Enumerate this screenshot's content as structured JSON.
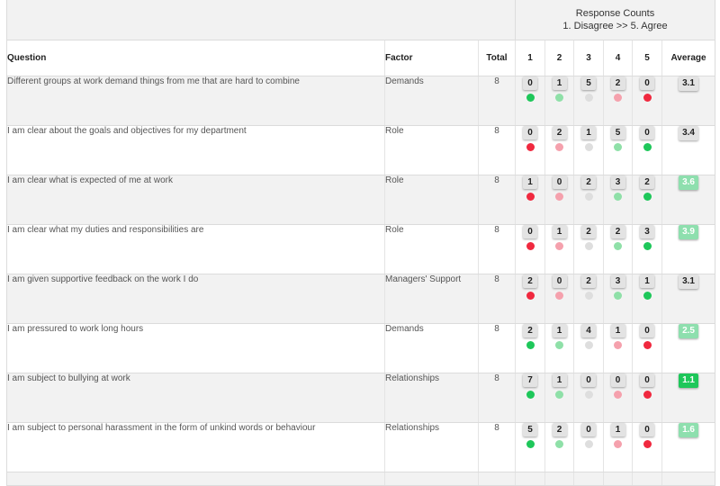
{
  "header": {
    "response_counts_title": "Response Counts",
    "scale_subtitle": "1. Disagree >> 5. Agree",
    "columns": {
      "question": "Question",
      "factor": "Factor",
      "total": "Total",
      "c1": "1",
      "c2": "2",
      "c3": "3",
      "c4": "4",
      "c5": "5",
      "average": "Average"
    }
  },
  "colors": {
    "green_strong": "#1ec75a",
    "green_light": "#8fe0a8",
    "grey": "#dedede",
    "pink": "#f5a1ad",
    "red": "#f0293f",
    "badge_grey": "#e3e3e3",
    "avg_green_light": "#8edfae",
    "avg_green_strong": "#1ec75a"
  },
  "rows": [
    {
      "question": "Different groups at work demand things from me that are hard to combine",
      "factor": "Demands",
      "total": "8",
      "counts": [
        "0",
        "1",
        "5",
        "2",
        "0"
      ],
      "dots": [
        "green_strong",
        "green_light",
        "grey",
        "pink",
        "red"
      ],
      "average": "3.1",
      "avg_style": "grey"
    },
    {
      "question": "I am clear about the goals and objectives for my department",
      "factor": "Role",
      "total": "8",
      "counts": [
        "0",
        "2",
        "1",
        "5",
        "0"
      ],
      "dots": [
        "red",
        "pink",
        "grey",
        "green_light",
        "green_strong"
      ],
      "average": "3.4",
      "avg_style": "grey"
    },
    {
      "question": "I am clear what is expected of me at work",
      "factor": "Role",
      "total": "8",
      "counts": [
        "1",
        "0",
        "2",
        "3",
        "2"
      ],
      "dots": [
        "red",
        "pink",
        "grey",
        "green_light",
        "green_strong"
      ],
      "average": "3.6",
      "avg_style": "green_light"
    },
    {
      "question": "I am clear what my duties and responsibilities are",
      "factor": "Role",
      "total": "8",
      "counts": [
        "0",
        "1",
        "2",
        "2",
        "3"
      ],
      "dots": [
        "red",
        "pink",
        "grey",
        "green_light",
        "green_strong"
      ],
      "average": "3.9",
      "avg_style": "green_light"
    },
    {
      "question": "I am given supportive feedback on the work I do",
      "factor": "Managers' Support",
      "total": "8",
      "counts": [
        "2",
        "0",
        "2",
        "3",
        "1"
      ],
      "dots": [
        "red",
        "pink",
        "grey",
        "green_light",
        "green_strong"
      ],
      "average": "3.1",
      "avg_style": "grey"
    },
    {
      "question": "I am pressured to work long hours",
      "factor": "Demands",
      "total": "8",
      "counts": [
        "2",
        "1",
        "4",
        "1",
        "0"
      ],
      "dots": [
        "green_strong",
        "green_light",
        "grey",
        "pink",
        "red"
      ],
      "average": "2.5",
      "avg_style": "green_light"
    },
    {
      "question": "I am subject to bullying at work",
      "factor": "Relationships",
      "total": "8",
      "counts": [
        "7",
        "1",
        "0",
        "0",
        "0"
      ],
      "dots": [
        "green_strong",
        "green_light",
        "grey",
        "pink",
        "red"
      ],
      "average": "1.1",
      "avg_style": "green_strong"
    },
    {
      "question": "I am subject to personal harassment in the form of unkind words or behaviour",
      "factor": "Relationships",
      "total": "8",
      "counts": [
        "5",
        "2",
        "0",
        "1",
        "0"
      ],
      "dots": [
        "green_strong",
        "green_light",
        "grey",
        "pink",
        "red"
      ],
      "average": "1.6",
      "avg_style": "green_light"
    }
  ]
}
